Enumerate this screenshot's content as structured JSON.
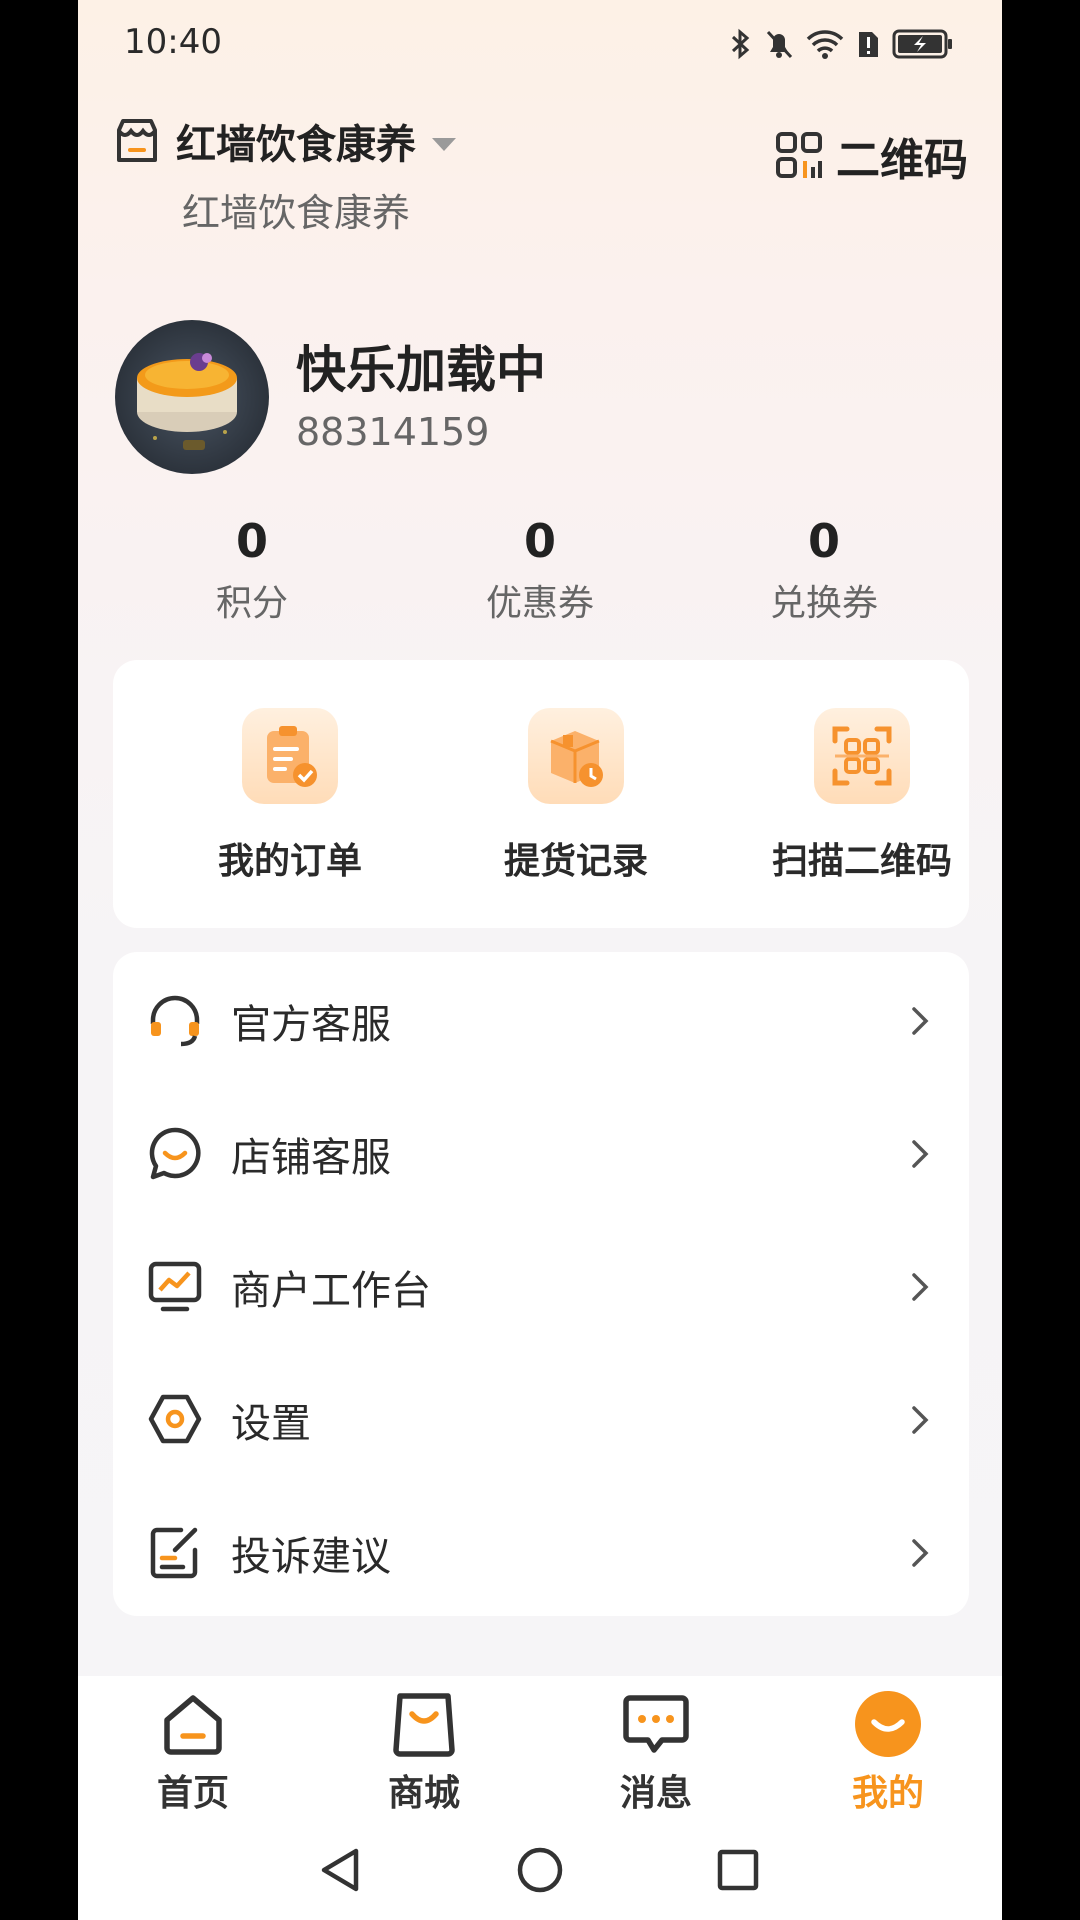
{
  "status_bar": {
    "time": "10:40"
  },
  "header": {
    "shop_name": "红墙饮食康养",
    "shop_subtitle": "红墙饮食康养",
    "qr_label": "二维码"
  },
  "profile": {
    "nickname": "快乐加载中",
    "id": "88314159"
  },
  "stats": [
    {
      "value": "0",
      "label": "积分"
    },
    {
      "value": "0",
      "label": "优惠券"
    },
    {
      "value": "0",
      "label": "兑换券"
    }
  ],
  "quick_actions": [
    {
      "label": "我的订单",
      "icon": "clipboard-check-icon"
    },
    {
      "label": "提货记录",
      "icon": "package-clock-icon"
    },
    {
      "label": "扫描二维码",
      "icon": "scan-qr-icon"
    }
  ],
  "menu": [
    {
      "label": "官方客服",
      "icon": "headset-icon"
    },
    {
      "label": "店铺客服",
      "icon": "chat-smile-icon"
    },
    {
      "label": "商户工作台",
      "icon": "monitor-chart-icon"
    },
    {
      "label": "设置",
      "icon": "hexagon-settings-icon"
    },
    {
      "label": "投诉建议",
      "icon": "edit-note-icon"
    }
  ],
  "tabs": [
    {
      "label": "首页",
      "icon": "home-icon"
    },
    {
      "label": "商城",
      "icon": "shopping-bag-icon"
    },
    {
      "label": "消息",
      "icon": "message-icon"
    },
    {
      "label": "我的",
      "icon": "smile-icon",
      "active": true
    }
  ],
  "colors": {
    "accent": "#f7941d",
    "text": "#2a2a2a",
    "muted": "#666666"
  }
}
